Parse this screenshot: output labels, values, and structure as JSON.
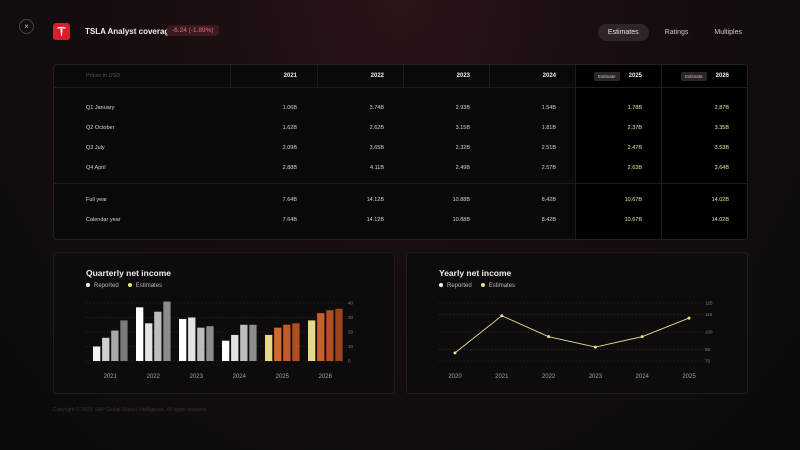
{
  "header": {
    "close_glyph": "×",
    "title": "TSLA Analyst coverage",
    "change": "-6.24 (-1.89%)",
    "tabs": [
      {
        "label": "Estimates",
        "active": true
      },
      {
        "label": "Ratings",
        "active": false
      },
      {
        "label": "Multiples",
        "active": false
      }
    ]
  },
  "table": {
    "corner_label": "Prices in USD",
    "estimate_tag": "Estimate",
    "years": [
      "2021",
      "2022",
      "2023",
      "2024",
      "2025",
      "2026"
    ],
    "estimate_years": [
      "2025",
      "2026"
    ],
    "rows": [
      {
        "label": "Q1 January",
        "values": [
          "1.06B",
          "3.74B",
          "2.93B",
          "1.54B",
          "1.78B",
          "2.87B"
        ]
      },
      {
        "label": "Q2 October",
        "values": [
          "1.62B",
          "2.62B",
          "3.15B",
          "1.81B",
          "2.37B",
          "3.35B"
        ]
      },
      {
        "label": "Q3 July",
        "values": [
          "2.09B",
          "3.65B",
          "2.32B",
          "2.51B",
          "2.47B",
          "3.53B"
        ]
      },
      {
        "label": "Q4 April",
        "values": [
          "2.88B",
          "4.11B",
          "2.49B",
          "2.57B",
          "2.63B",
          "3.64B"
        ]
      },
      {
        "label": "Full year",
        "values": [
          "7.64B",
          "14.12B",
          "10.88B",
          "8.42B",
          "10.67B",
          "14.02B"
        ]
      },
      {
        "label": "Calendar year",
        "values": [
          "7.64B",
          "14.12B",
          "10.88B",
          "8.42B",
          "10.67B",
          "14.02B"
        ]
      }
    ]
  },
  "legend": {
    "reported": "Reported",
    "estimates": "Estimates"
  },
  "colors": {
    "accent": "#d91e2a",
    "reported_dot": "#f2f2f2",
    "estimate_dot": "#e8e07a",
    "estimate_text": "#e9ec9a",
    "line": "#e6df8f"
  },
  "chart_data": [
    {
      "type": "bar",
      "title": "Quarterly net income",
      "categories": [
        "2021",
        "2022",
        "2023",
        "2024",
        "2025",
        "2026"
      ],
      "ylim": [
        0,
        40
      ],
      "yticks": [
        "40",
        "30",
        "20",
        "10",
        "0"
      ],
      "series": [
        {
          "name": "Reported",
          "values": [
            [
              10,
              16,
              21,
              28
            ],
            [
              37,
              26,
              34,
              41
            ],
            [
              29,
              30,
              23,
              24
            ],
            [
              14,
              18,
              25,
              25
            ],
            [
              18,
              23,
              25,
              26
            ],
            [
              28,
              33,
              35,
              36
            ]
          ]
        }
      ],
      "estimate_categories": [
        "2025",
        "2026"
      ],
      "grid": true,
      "legend_position": "top-left"
    },
    {
      "type": "line",
      "title": "Yearly net income",
      "x": [
        "2020",
        "2021",
        "2022",
        "2023",
        "2024",
        "2025"
      ],
      "y": [
        82,
        114,
        96,
        87,
        96,
        112
      ],
      "ylim": [
        75,
        125
      ],
      "yticks": [
        "125",
        "115",
        "100",
        "85",
        "75"
      ],
      "grid": true,
      "legend_position": "top-left"
    }
  ],
  "footer": {
    "copyright": "Copyright © 2023, S&P Global Market Intelligence. All rights reserved."
  }
}
